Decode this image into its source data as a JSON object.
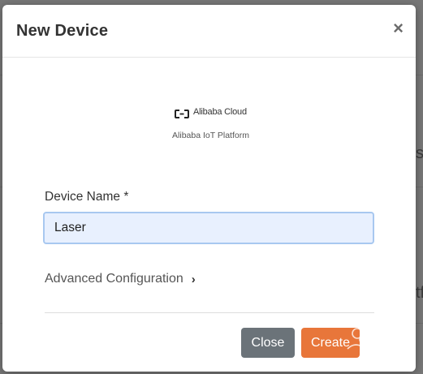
{
  "modal": {
    "title": "New Device",
    "close_icon": "×"
  },
  "brand": {
    "logo_text": "Alibaba Cloud",
    "logo_icon": "alibaba-cloud-logo-icon",
    "platform": "Alibaba IoT Platform"
  },
  "form": {
    "device_name_label": "Device Name *",
    "device_name_value": "Laser",
    "advanced_label": "Advanced Configuration",
    "advanced_icon": "chevron-right-icon"
  },
  "buttons": {
    "close": "Close",
    "create": "Create"
  },
  "background": {
    "text_a": "s",
    "text_b": "tf"
  },
  "colors": {
    "create": "#e8763a",
    "close": "#6b7379",
    "input_bg": "#e8f0fe",
    "input_border": "#a8c8f0"
  }
}
